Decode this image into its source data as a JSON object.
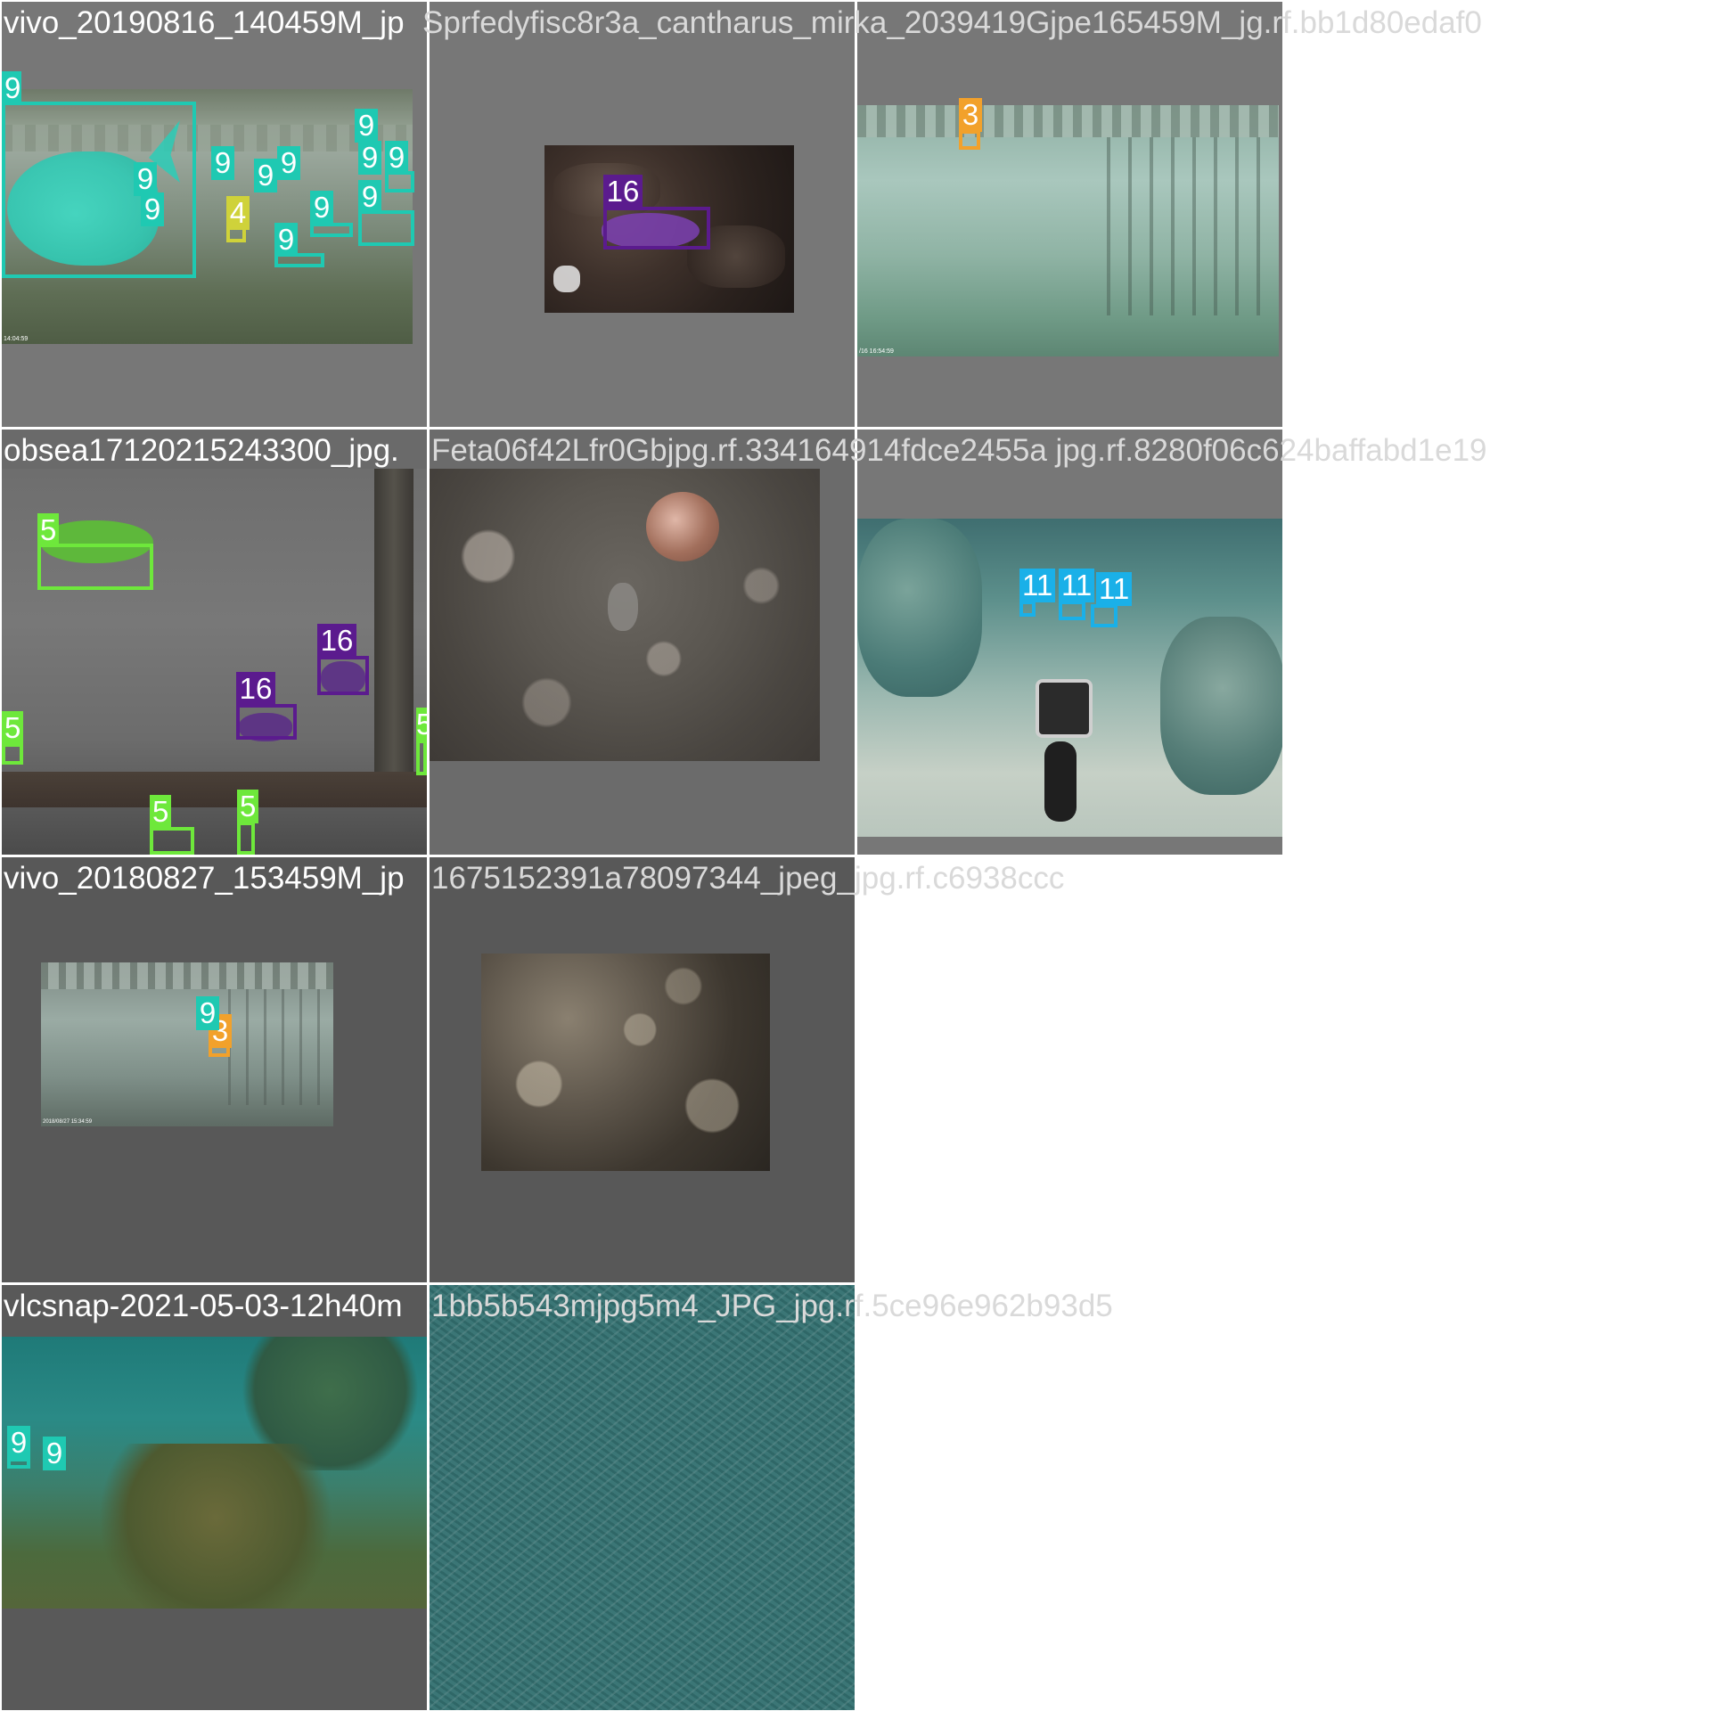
{
  "grid_title": "",
  "tiles": [
    {
      "id": "t1",
      "filename_start": "vivo_20190816_140459M_jp",
      "filename_overflow": "g.rf.bb1d80edaf0",
      "overlap_text": "Sprfedyfisc8r3a_cantharus_mirka_2039419Gjpe165459M_j"
    },
    {
      "id": "t2",
      "filename_start": "Sparodus_canthar",
      "filename_overflow": ""
    },
    {
      "id": "t3",
      "filename_start": "vivo_201",
      "filename_overflow": ""
    },
    {
      "id": "t4",
      "filename_start": "obsea17120215243300_jpg.",
      "filename_overflow": ".8280f06c624baffabd1e19",
      "overlap_text": "Feta06f42Lfr0Gbjpg.rf.334164914fdce2455a jpg.rf"
    },
    {
      "id": "t7",
      "filename_start": "vivo_20180827_153459M_jp",
      "filename_overflow": "g_jpg.rf.c6938ccc",
      "overlap_text": "1675152391a78097344_jpe"
    },
    {
      "id": "t9",
      "filename_start": "vlcsnap-2021-05-03-12h40m",
      "filename_overflow": ".5ce96e962b93d5",
      "overlap_text": "1bb5b543mjpg5m4_JPG_jpg.rf"
    }
  ],
  "labels": {
    "nine": "9",
    "four": "4",
    "three": "3",
    "five": "5",
    "sixteen": "16",
    "eleven": "11"
  },
  "timestamps": {
    "t1": "14:04:59",
    "t3": "/16 16:54:59",
    "t7": "2018/08/27 15:34:59"
  },
  "colors": {
    "class_9": "#1fc9b2",
    "class_4": "#cfd23a",
    "class_3": "#f2a12b",
    "class_5": "#6ee83b",
    "class_16": "#5b1b8e",
    "class_11": "#1ab0e8",
    "tile_bg": "#6f6f6f",
    "tile_bg_dark": "#595959"
  }
}
